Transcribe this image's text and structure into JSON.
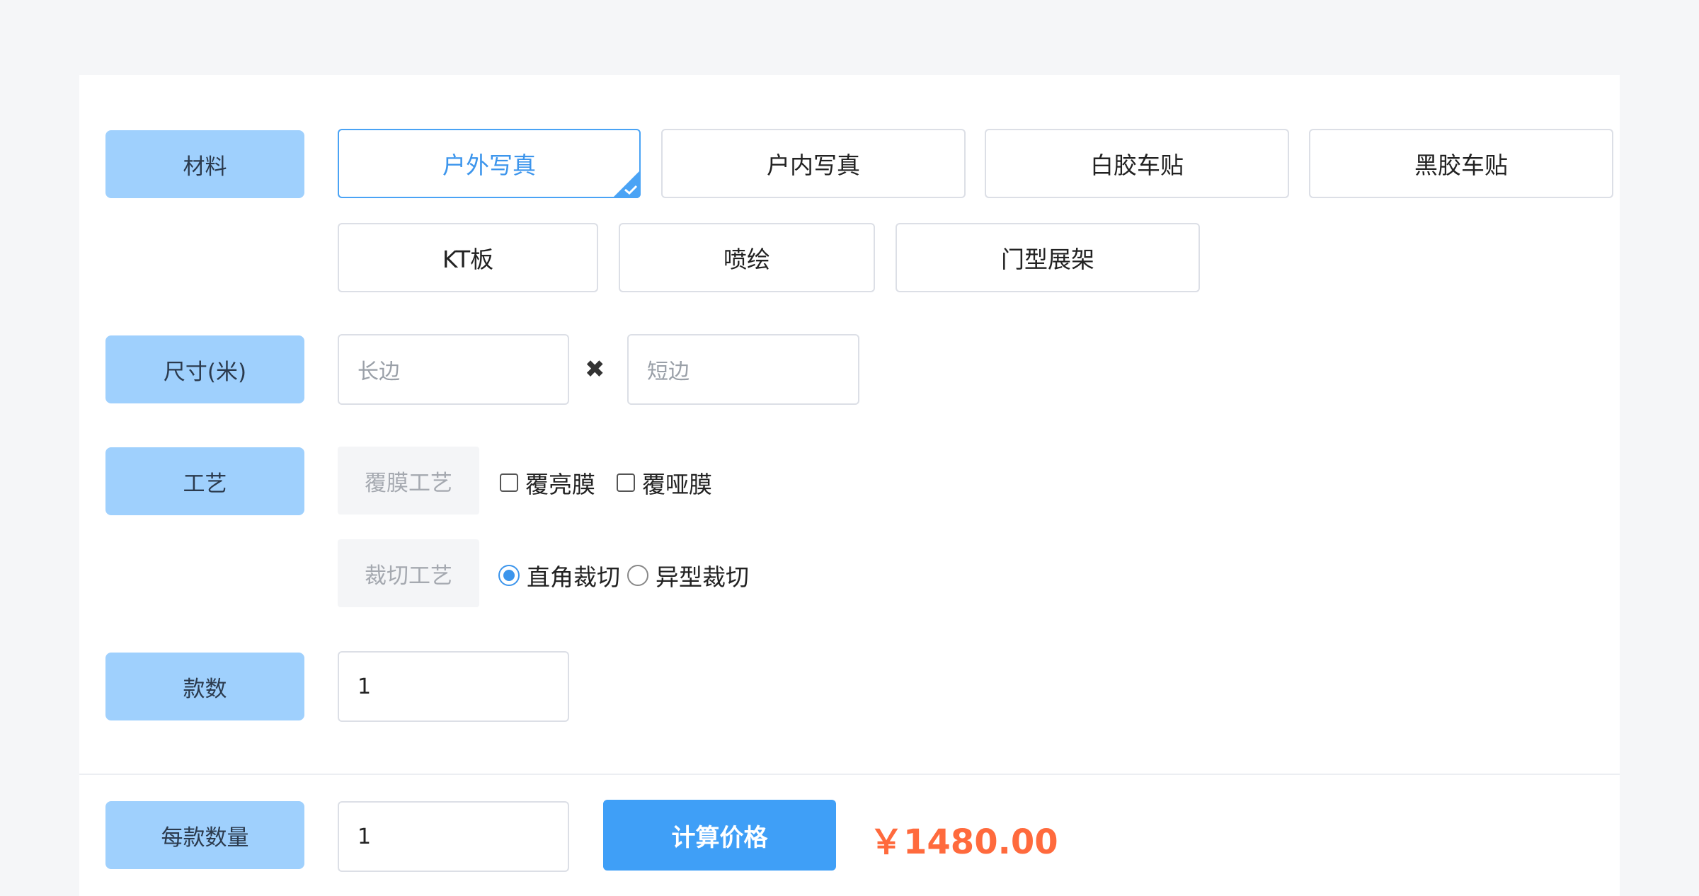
{
  "labels": {
    "material": "材料",
    "size": "尺寸(米)",
    "process": "工艺",
    "styles": "款数",
    "qty_per_style": "每款数量"
  },
  "materials": [
    {
      "label": "户外写真",
      "selected": true
    },
    {
      "label": "户内写真",
      "selected": false
    },
    {
      "label": "白胶车贴",
      "selected": false
    },
    {
      "label": "黑胶车贴",
      "selected": false
    },
    {
      "label": "KT板",
      "selected": false
    },
    {
      "label": "喷绘",
      "selected": false
    },
    {
      "label": "门型展架",
      "selected": false
    }
  ],
  "size": {
    "long_placeholder": "长边",
    "short_placeholder": "短边",
    "separator": "✖"
  },
  "process": {
    "lamination_label": "覆膜工艺",
    "lamination_options": [
      {
        "label": "覆亮膜",
        "checked": false
      },
      {
        "label": "覆哑膜",
        "checked": false
      }
    ],
    "cutting_label": "裁切工艺",
    "cutting_options": [
      {
        "label": "直角裁切",
        "checked": true
      },
      {
        "label": "异型裁切",
        "checked": false
      }
    ]
  },
  "styles_value": "1",
  "qty_value": "1",
  "calc_button": "计算价格",
  "price": "￥1480.00",
  "colors": {
    "accent": "#3f9ff7",
    "label_bg": "#9fd0fd",
    "price": "#ff6a3d"
  }
}
